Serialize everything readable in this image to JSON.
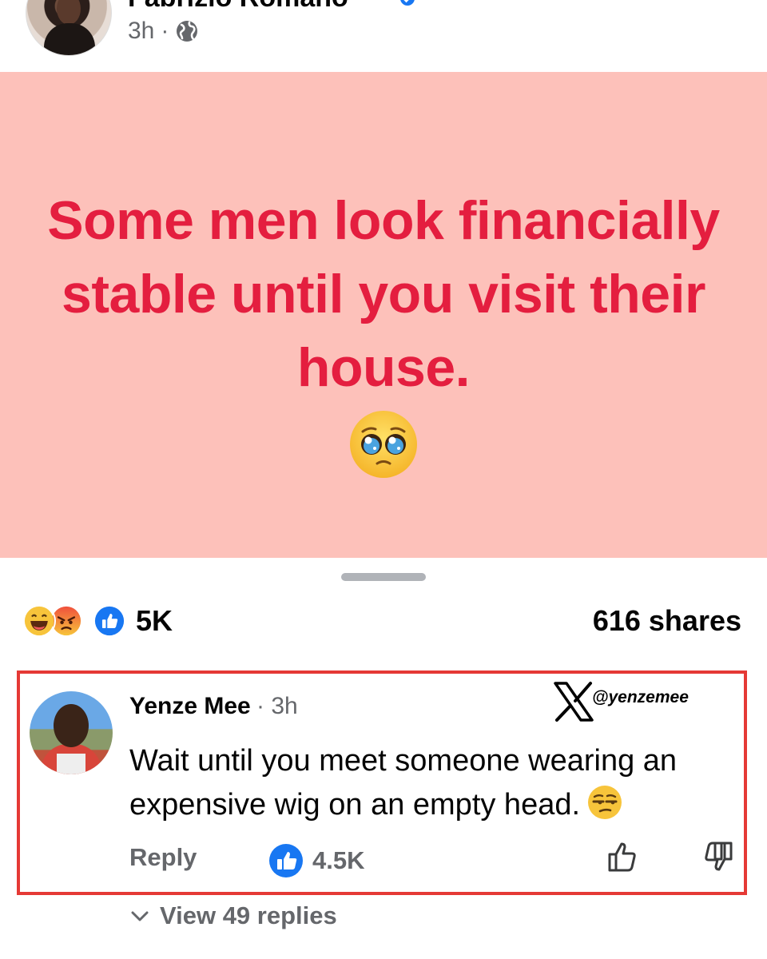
{
  "post": {
    "author_name": "Fabrizio Romano",
    "time": "3h",
    "separator": "·",
    "text": "Some men look financially stable until you visit their house.",
    "emoji": "pleading-face"
  },
  "reactions": {
    "icons": [
      "laugh-reaction",
      "angry-reaction",
      "like-reaction"
    ],
    "count": "5K",
    "shares": "616 shares"
  },
  "comment": {
    "author": "Yenze Mee",
    "time": "· 3h",
    "text": "Wait until you meet someone wearing an expensive wig on an empty head.",
    "emoji": "unamused-face",
    "reply_label": "Reply",
    "likes": "4.5K",
    "watermark_handle": "@yenzemee",
    "highlight_color": "#e53935"
  },
  "view_replies_label": "View 49 replies",
  "colors": {
    "banner_bg": "#fdc1ba",
    "banner_text": "#e41e3f",
    "facebook_blue": "#1877f2",
    "secondary_text": "#65676b"
  }
}
